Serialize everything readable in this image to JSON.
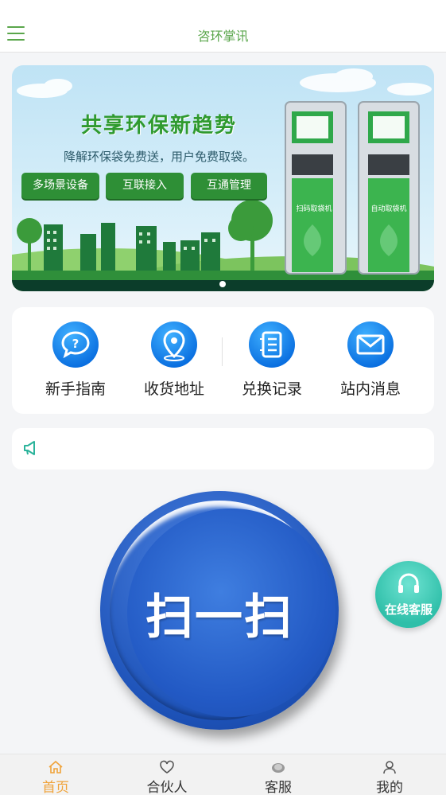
{
  "header": {
    "title": "咨环掌讯",
    "menu_icon": "hamburger-menu-icon"
  },
  "banner": {
    "headline": "共享环保新趋势",
    "subtitle": "降解环保袋免费送，用户免费取袋。",
    "tags": [
      "多场景设备",
      "互联接入",
      "互通管理"
    ],
    "machine_left_label": "扫码取袋机",
    "machine_right_label": "自动取袋机",
    "slide_count": 1,
    "active_slide": 1
  },
  "quick_links": [
    {
      "label": "新手指南",
      "icon": "question-bubble-icon"
    },
    {
      "label": "收货地址",
      "icon": "map-pin-icon"
    },
    {
      "label": "兑换记录",
      "icon": "list-document-icon"
    },
    {
      "label": "站内消息",
      "icon": "mail-icon"
    }
  ],
  "notice": {
    "icon": "megaphone-icon",
    "text": ""
  },
  "scan": {
    "label": "扫一扫"
  },
  "floating_service": {
    "label": "在线客服",
    "icon": "headset-icon"
  },
  "tabbar": {
    "active": "首页",
    "items": [
      {
        "label": "首页",
        "icon": "home-icon"
      },
      {
        "label": "合伙人",
        "icon": "heart-icon"
      },
      {
        "label": "客服",
        "icon": "service-icon"
      },
      {
        "label": "我的",
        "icon": "user-icon"
      }
    ]
  },
  "colors": {
    "brand_green": "#5aa64b",
    "accent_blue": "#1d52b8",
    "tab_active": "#f0a33a",
    "service_teal": "#2fbfa9"
  }
}
